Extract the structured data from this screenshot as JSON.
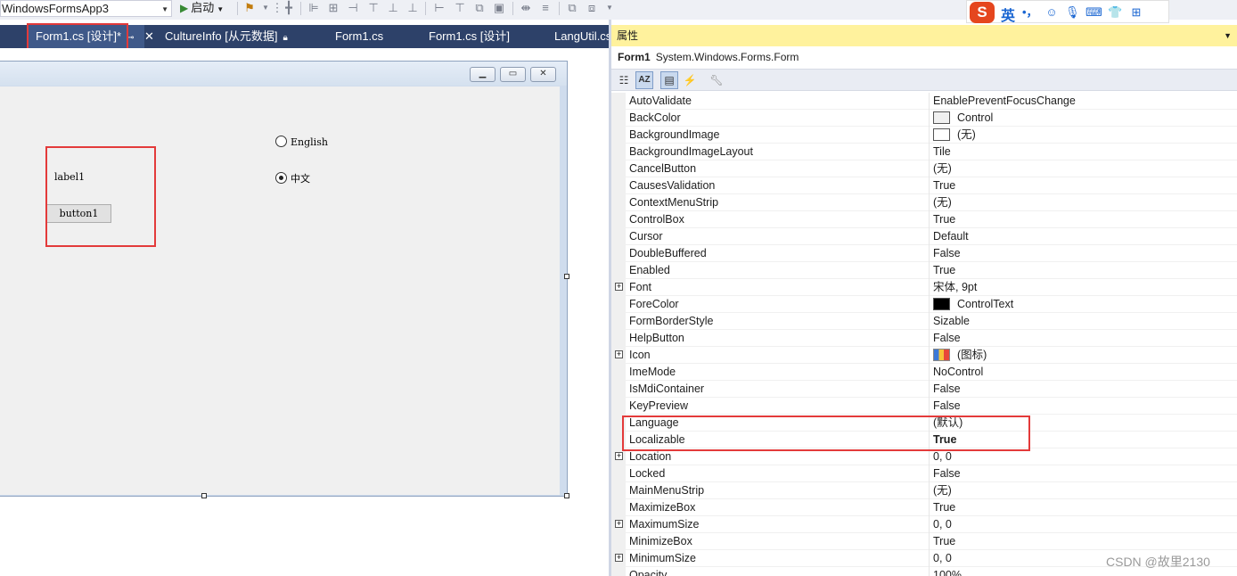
{
  "toolbar": {
    "project": "WindowsFormsApp3",
    "start_label": "启动",
    "icons": [
      "browser-link-icon",
      "align-lefts-icon",
      "align-centers-icon",
      "align-rights-icon",
      "align-tops-icon",
      "align-middles-icon",
      "align-bottoms-icon",
      "make-same-width-icon",
      "make-same-height-icon",
      "make-same-size-icon",
      "size-to-grid-icon",
      "horizontal-spacing-icon",
      "vertical-spacing-icon",
      "center-horizontally-icon",
      "bring-to-front-icon"
    ]
  },
  "ime": {
    "lang": "英",
    "punct": "•，"
  },
  "tabs": [
    {
      "label": "Form1.cs [设计]*",
      "active": true
    },
    {
      "label": "CultureInfo [从元数据]"
    },
    {
      "label": "Form1.cs"
    },
    {
      "label": "Form1.cs [设计]"
    },
    {
      "label": "LangUtil.cs"
    }
  ],
  "designer": {
    "label1": "label1",
    "button1": "button1",
    "radio_english": "English",
    "radio_chinese": "中文",
    "selected_radio": "中文",
    "caption_buttons": [
      "▭",
      "▢",
      "✕"
    ]
  },
  "properties": {
    "title": "属性",
    "object_name": "Form1",
    "object_type": "System.Windows.Forms.Form",
    "rows": [
      {
        "name": "AutoValidate",
        "value": "EnablePreventFocusChange"
      },
      {
        "name": "BackColor",
        "value": "Control",
        "swatch": "#f0f0f0"
      },
      {
        "name": "BackgroundImage",
        "value": "(无)",
        "swatch": "#ffffff"
      },
      {
        "name": "BackgroundImageLayout",
        "value": "Tile"
      },
      {
        "name": "CancelButton",
        "value": "(无)"
      },
      {
        "name": "CausesValidation",
        "value": "True"
      },
      {
        "name": "ContextMenuStrip",
        "value": "(无)"
      },
      {
        "name": "ControlBox",
        "value": "True"
      },
      {
        "name": "Cursor",
        "value": "Default"
      },
      {
        "name": "DoubleBuffered",
        "value": "False"
      },
      {
        "name": "Enabled",
        "value": "True"
      },
      {
        "name": "Font",
        "value": "宋体, 9pt",
        "expandable": true
      },
      {
        "name": "ForeColor",
        "value": "ControlText",
        "swatch": "#000000"
      },
      {
        "name": "FormBorderStyle",
        "value": "Sizable"
      },
      {
        "name": "HelpButton",
        "value": "False"
      },
      {
        "name": "Icon",
        "value": "(图标)",
        "expandable": true,
        "icon": true
      },
      {
        "name": "ImeMode",
        "value": "NoControl"
      },
      {
        "name": "IsMdiContainer",
        "value": "False"
      },
      {
        "name": "KeyPreview",
        "value": "False"
      },
      {
        "name": "Language",
        "value": "(默认)"
      },
      {
        "name": "Localizable",
        "value": "True",
        "bold": true
      },
      {
        "name": "Location",
        "value": "0, 0",
        "expandable": true
      },
      {
        "name": "Locked",
        "value": "False"
      },
      {
        "name": "MainMenuStrip",
        "value": "(无)"
      },
      {
        "name": "MaximizeBox",
        "value": "True"
      },
      {
        "name": "MaximumSize",
        "value": "0, 0",
        "expandable": true
      },
      {
        "name": "MinimizeBox",
        "value": "True"
      },
      {
        "name": "MinimumSize",
        "value": "0, 0",
        "expandable": true
      },
      {
        "name": "Opacity",
        "value": "100%"
      }
    ]
  },
  "watermark": "CSDN @故里2130",
  "colors": {
    "highlight_box": "#e33a3a",
    "tab_bar": "#2d4169",
    "props_title": "#fff29d"
  }
}
